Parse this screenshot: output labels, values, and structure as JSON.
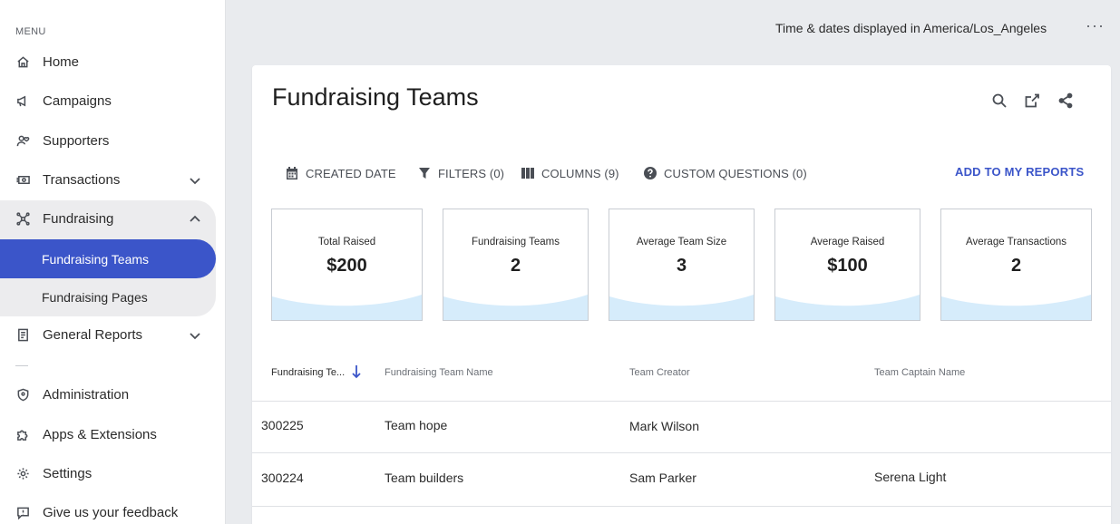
{
  "sidebar": {
    "menu_label": "MENU",
    "items": [
      {
        "label": "Home",
        "icon": "home-icon"
      },
      {
        "label": "Campaigns",
        "icon": "megaphone-icon"
      },
      {
        "label": "Supporters",
        "icon": "supporter-icon"
      },
      {
        "label": "Transactions",
        "icon": "money-icon"
      },
      {
        "label": "Fundraising",
        "icon": "fundraising-icon"
      },
      {
        "label": "General Reports",
        "icon": "report-icon"
      },
      {
        "label": "Administration",
        "icon": "shield-icon"
      },
      {
        "label": "Apps & Extensions",
        "icon": "puzzle-icon"
      },
      {
        "label": "Settings",
        "icon": "gear-icon"
      },
      {
        "label": "Give us your feedback",
        "icon": "feedback-icon"
      }
    ],
    "sub_items": [
      {
        "label": "Fundraising Teams",
        "active": true
      },
      {
        "label": "Fundraising Pages",
        "active": false
      }
    ],
    "active_color": "#3b55c9"
  },
  "topbar": {
    "timezone_text": "Time & dates displayed in America/Los_Angeles",
    "more_label": "···"
  },
  "report": {
    "title": "Fundraising Teams",
    "tools": [
      "search-icon",
      "export-icon",
      "share-icon"
    ],
    "filters": [
      {
        "label": "CREATED DATE",
        "icon": "calendar-icon"
      },
      {
        "label": "FILTERS (0)",
        "icon": "filter-icon"
      },
      {
        "label": "COLUMNS (9)",
        "icon": "columns-icon"
      },
      {
        "label": "CUSTOM QUESTIONS (0)",
        "icon": "question-icon"
      }
    ],
    "add_to_reports": "ADD TO MY REPORTS",
    "stats": [
      {
        "label": "Total Raised",
        "value": "$200"
      },
      {
        "label": "Fundraising Teams",
        "value": "2"
      },
      {
        "label": "Average Team Size",
        "value": "3"
      },
      {
        "label": "Average Raised",
        "value": "$100"
      },
      {
        "label": "Average Transactions",
        "value": "2"
      }
    ],
    "table": {
      "headers": [
        "Fundraising Te...",
        "Fundraising Team Name",
        "Team Creator",
        "Team Captain Name"
      ],
      "rows": [
        [
          "300225",
          "Team hope",
          "Mark Wilson",
          ""
        ],
        [
          "300224",
          "Team builders",
          "Sam Parker",
          "Serena Light"
        ]
      ]
    }
  }
}
